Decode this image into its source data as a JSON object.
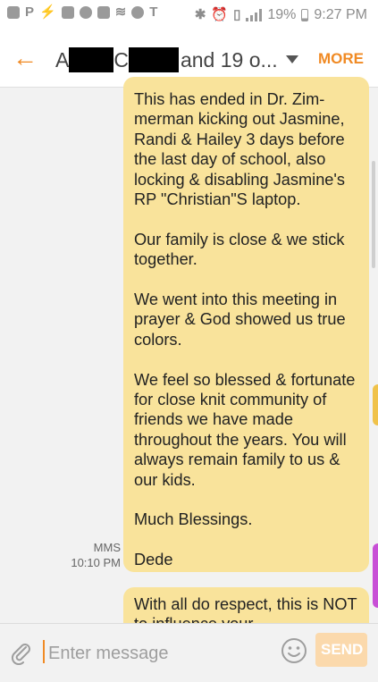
{
  "status_bar": {
    "battery": "19%",
    "time": "9:27 PM"
  },
  "header": {
    "title_a": "A",
    "title_c": "C",
    "title_rest": "and 19 o...",
    "more_label": "MORE"
  },
  "messages": [
    {
      "paragraphs": [
        "This has ended in Dr. Zim-merman kicking out Jasmine, Randi & Hailey 3 days before the last day of school, also locking & disabling Jasmine's RP \"Christian\"S laptop.",
        "Our family is close & we stick together.",
        "We went into this meeting in prayer & God showed us true colors.",
        "We feel so blessed & fortunate for close knit community of friends we have made throughout the years. You will always remain family to us & our kids.",
        "Much Blessings.",
        "Dede"
      ],
      "type_label": "MMS",
      "time": "10:10 PM"
    },
    {
      "text": "With all do respect, this is NOT to influence your"
    }
  ],
  "compose": {
    "placeholder": "Enter message",
    "send_label": "SEND"
  },
  "colors": {
    "accent": "#f08a24",
    "bubble": "#f9e39b"
  }
}
